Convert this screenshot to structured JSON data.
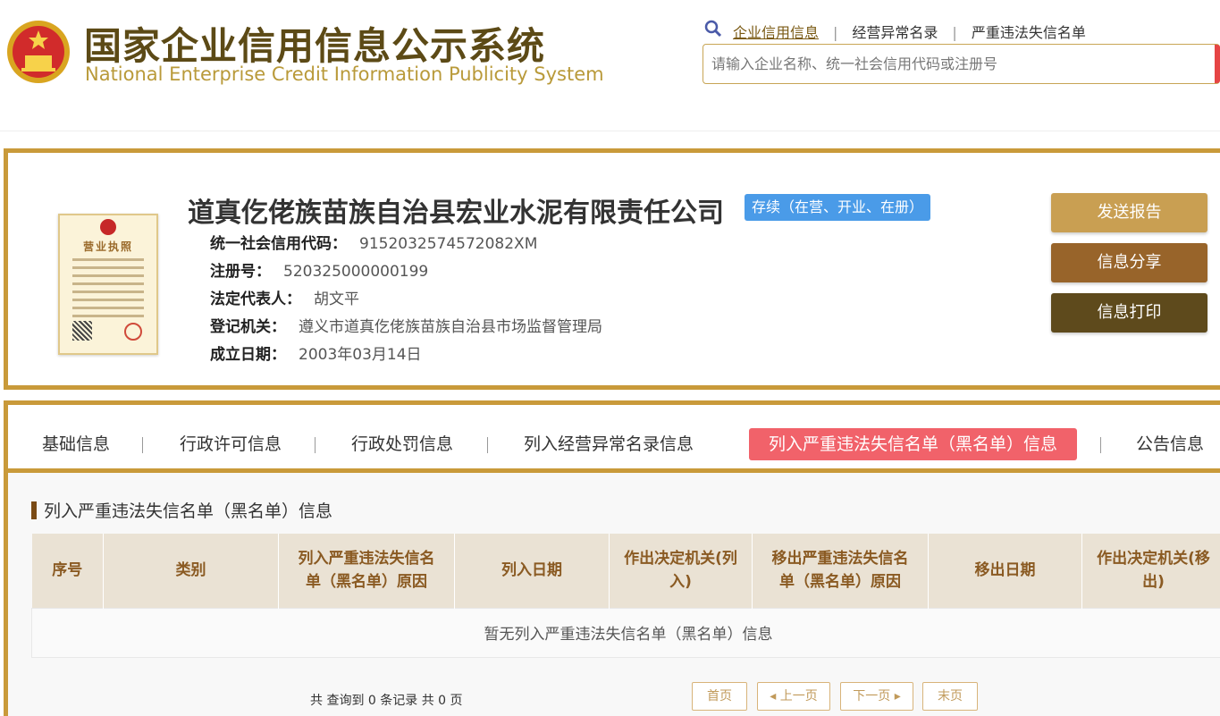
{
  "header": {
    "title_cn": "国家企业信用信息公示系统",
    "title_en": "National Enterprise Credit Information Publicity System",
    "nav": [
      {
        "label": "企业信用信息"
      },
      {
        "label": "经营异常名录"
      },
      {
        "label": "严重违法失信名单"
      }
    ],
    "search_placeholder": "请输入企业名称、统一社会信用代码或注册号"
  },
  "company": {
    "name": "道真仡佬族苗族自治县宏业水泥有限责任公司",
    "status": "存续（在营、开业、在册）",
    "license_title": "营业执照",
    "fields": [
      {
        "label": "统一社会信用代码：",
        "value": "9152032574572082XM"
      },
      {
        "label": "注册号：",
        "value": "520325000000199"
      },
      {
        "label": "法定代表人：",
        "value": "胡文平"
      },
      {
        "label": "登记机关：",
        "value": "遵义市道真仡佬族苗族自治县市场监督管理局"
      },
      {
        "label": "成立日期：",
        "value": "2003年03月14日"
      }
    ],
    "actions": {
      "send": "发送报告",
      "share": "信息分享",
      "print": "信息打印"
    }
  },
  "tabs": [
    {
      "label": "基础信息"
    },
    {
      "label": "行政许可信息"
    },
    {
      "label": "行政处罚信息"
    },
    {
      "label": "列入经营异常名录信息"
    },
    {
      "label": "列入严重违法失信名单（黑名单）信息"
    },
    {
      "label": "公告信息"
    }
  ],
  "section": {
    "title": "列入严重违法失信名单（黑名单）信息",
    "columns": [
      "序号",
      "类别",
      "列入严重违法失信名单（黑名单）原因",
      "列入日期",
      "作出决定机关(列入)",
      "移出严重违法失信名单（黑名单）原因",
      "移出日期",
      "作出决定机关(移出)"
    ],
    "empty_text": "暂无列入严重违法失信名单（黑名单）信息",
    "record_info": "共 查询到 0 条记录 共 0 页",
    "pager": {
      "first": "首页",
      "prev": "◂ 上一页",
      "next": "下一页 ▸",
      "last": "末页"
    }
  },
  "colors": {
    "gold_border": "#c99a3a",
    "active_tab": "#f1626a",
    "status_blue": "#4a9be8"
  }
}
